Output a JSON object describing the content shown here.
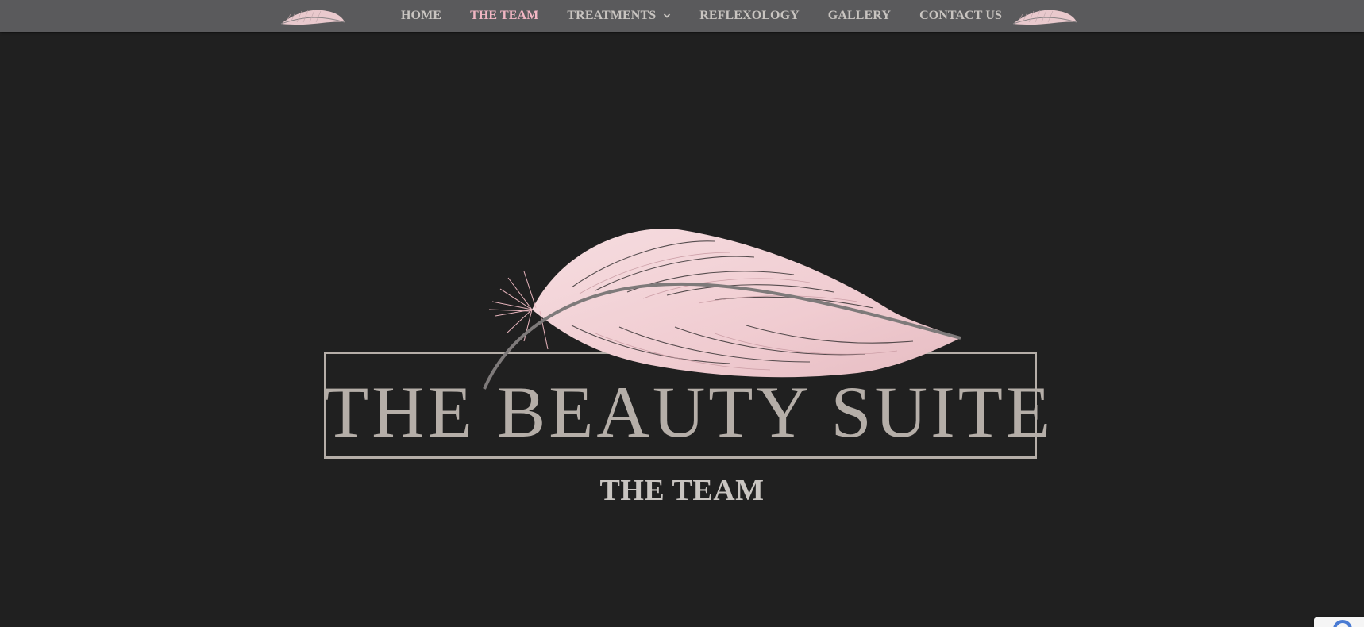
{
  "nav": {
    "items": [
      {
        "label": "HOME",
        "active": false,
        "has_dropdown": false
      },
      {
        "label": "THE TEAM",
        "active": true,
        "has_dropdown": false
      },
      {
        "label": "TREATMENTS",
        "active": false,
        "has_dropdown": true
      },
      {
        "label": "REFLEXOLOGY",
        "active": false,
        "has_dropdown": false
      },
      {
        "label": "GALLERY",
        "active": false,
        "has_dropdown": false
      },
      {
        "label": "CONTACT US",
        "active": false,
        "has_dropdown": false
      }
    ],
    "dropdown_icon": "chevron-down-icon",
    "decor_icon": "feather-icon"
  },
  "hero": {
    "logo_text": "THE BEAUTY SUITE",
    "heading": "THE TEAM"
  },
  "colors": {
    "background": "#202020",
    "navbar": "#5a5a5c",
    "nav_text": "#c8c4c0",
    "nav_active": "#f2b6c3",
    "logo_gray": "#b5aea8",
    "feather_pink": "#f4d3d6"
  }
}
